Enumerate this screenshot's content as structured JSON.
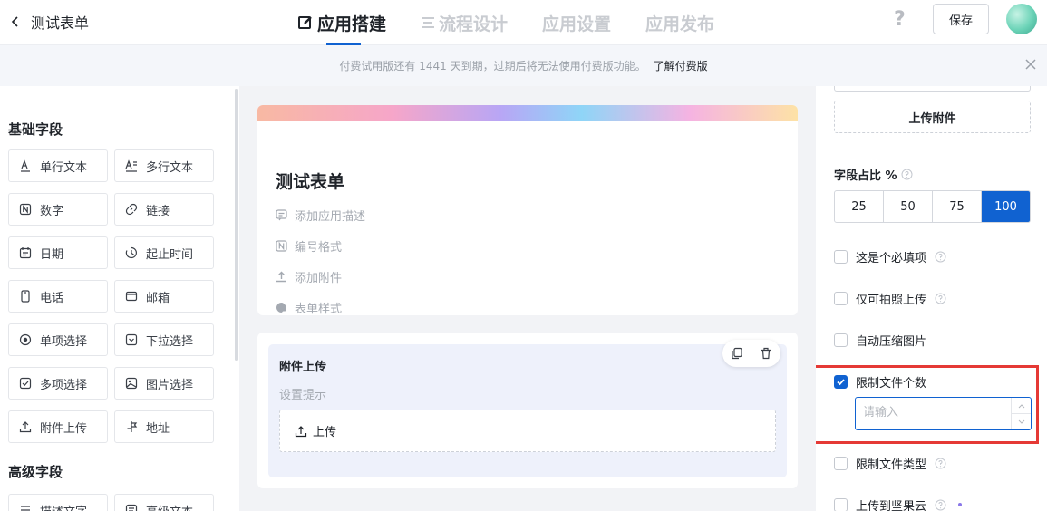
{
  "header": {
    "back_label": "测试表单",
    "tabs": [
      {
        "label": "应用搭建",
        "active": true
      },
      {
        "label": "流程设计",
        "active": false
      },
      {
        "label": "应用设置",
        "active": false
      },
      {
        "label": "应用发布",
        "active": false
      }
    ],
    "help_label": "?",
    "save_label": "保存"
  },
  "banner": {
    "text": "付费试用版还有 1441 天到期，过期后将无法使用付费版功能。",
    "link": "了解付费版"
  },
  "sidebar": {
    "basic_title": "基础字段",
    "basic_fields": [
      {
        "label": "单行文本",
        "icon": "text-line-icon"
      },
      {
        "label": "多行文本",
        "icon": "text-multi-icon"
      },
      {
        "label": "数字",
        "icon": "number-icon"
      },
      {
        "label": "链接",
        "icon": "link-icon"
      },
      {
        "label": "日期",
        "icon": "calendar-icon"
      },
      {
        "label": "起止时间",
        "icon": "time-range-icon"
      },
      {
        "label": "电话",
        "icon": "phone-icon"
      },
      {
        "label": "邮箱",
        "icon": "mail-icon"
      },
      {
        "label": "单项选择",
        "icon": "radio-icon"
      },
      {
        "label": "下拉选择",
        "icon": "dropdown-icon"
      },
      {
        "label": "多项选择",
        "icon": "checkbox-icon"
      },
      {
        "label": "图片选择",
        "icon": "image-icon"
      },
      {
        "label": "附件上传",
        "icon": "upload-icon"
      },
      {
        "label": "地址",
        "icon": "location-icon"
      }
    ],
    "advanced_title": "高级字段",
    "advanced_fields": [
      {
        "label": "描述文字",
        "icon": "description-icon"
      },
      {
        "label": "高级文本",
        "icon": "rich-text-icon"
      }
    ]
  },
  "form": {
    "title": "测试表单",
    "options": [
      {
        "label": "添加应用描述",
        "icon": "comment-icon"
      },
      {
        "label": "编号格式",
        "icon": "number-icon"
      },
      {
        "label": "添加附件",
        "icon": "upload-icon"
      },
      {
        "label": "表单样式",
        "icon": "palette-icon"
      }
    ],
    "upload_field": {
      "label": "附件上传",
      "hint": "设置提示",
      "button": "上传"
    }
  },
  "panel": {
    "attach_button": "上传附件",
    "ratio_title": "字段占比 %",
    "ratios": [
      {
        "label": "25",
        "active": false
      },
      {
        "label": "50",
        "active": false
      },
      {
        "label": "75",
        "active": false
      },
      {
        "label": "100",
        "active": true
      }
    ],
    "checks": [
      {
        "label": "这是个必填项",
        "checked": false,
        "help": true
      },
      {
        "label": "仅可拍照上传",
        "checked": false,
        "help": true
      },
      {
        "label": "自动压缩图片",
        "checked": false,
        "help": false
      },
      {
        "label": "限制文件个数",
        "checked": true,
        "help": false
      },
      {
        "label": "限制文件类型",
        "checked": false,
        "help": true
      },
      {
        "label": "上传到坚果云",
        "checked": false,
        "help": true
      }
    ],
    "limit_input_placeholder": "请输入"
  },
  "colors": {
    "accent": "#1062d1",
    "highlight_frame": "#e53935"
  }
}
